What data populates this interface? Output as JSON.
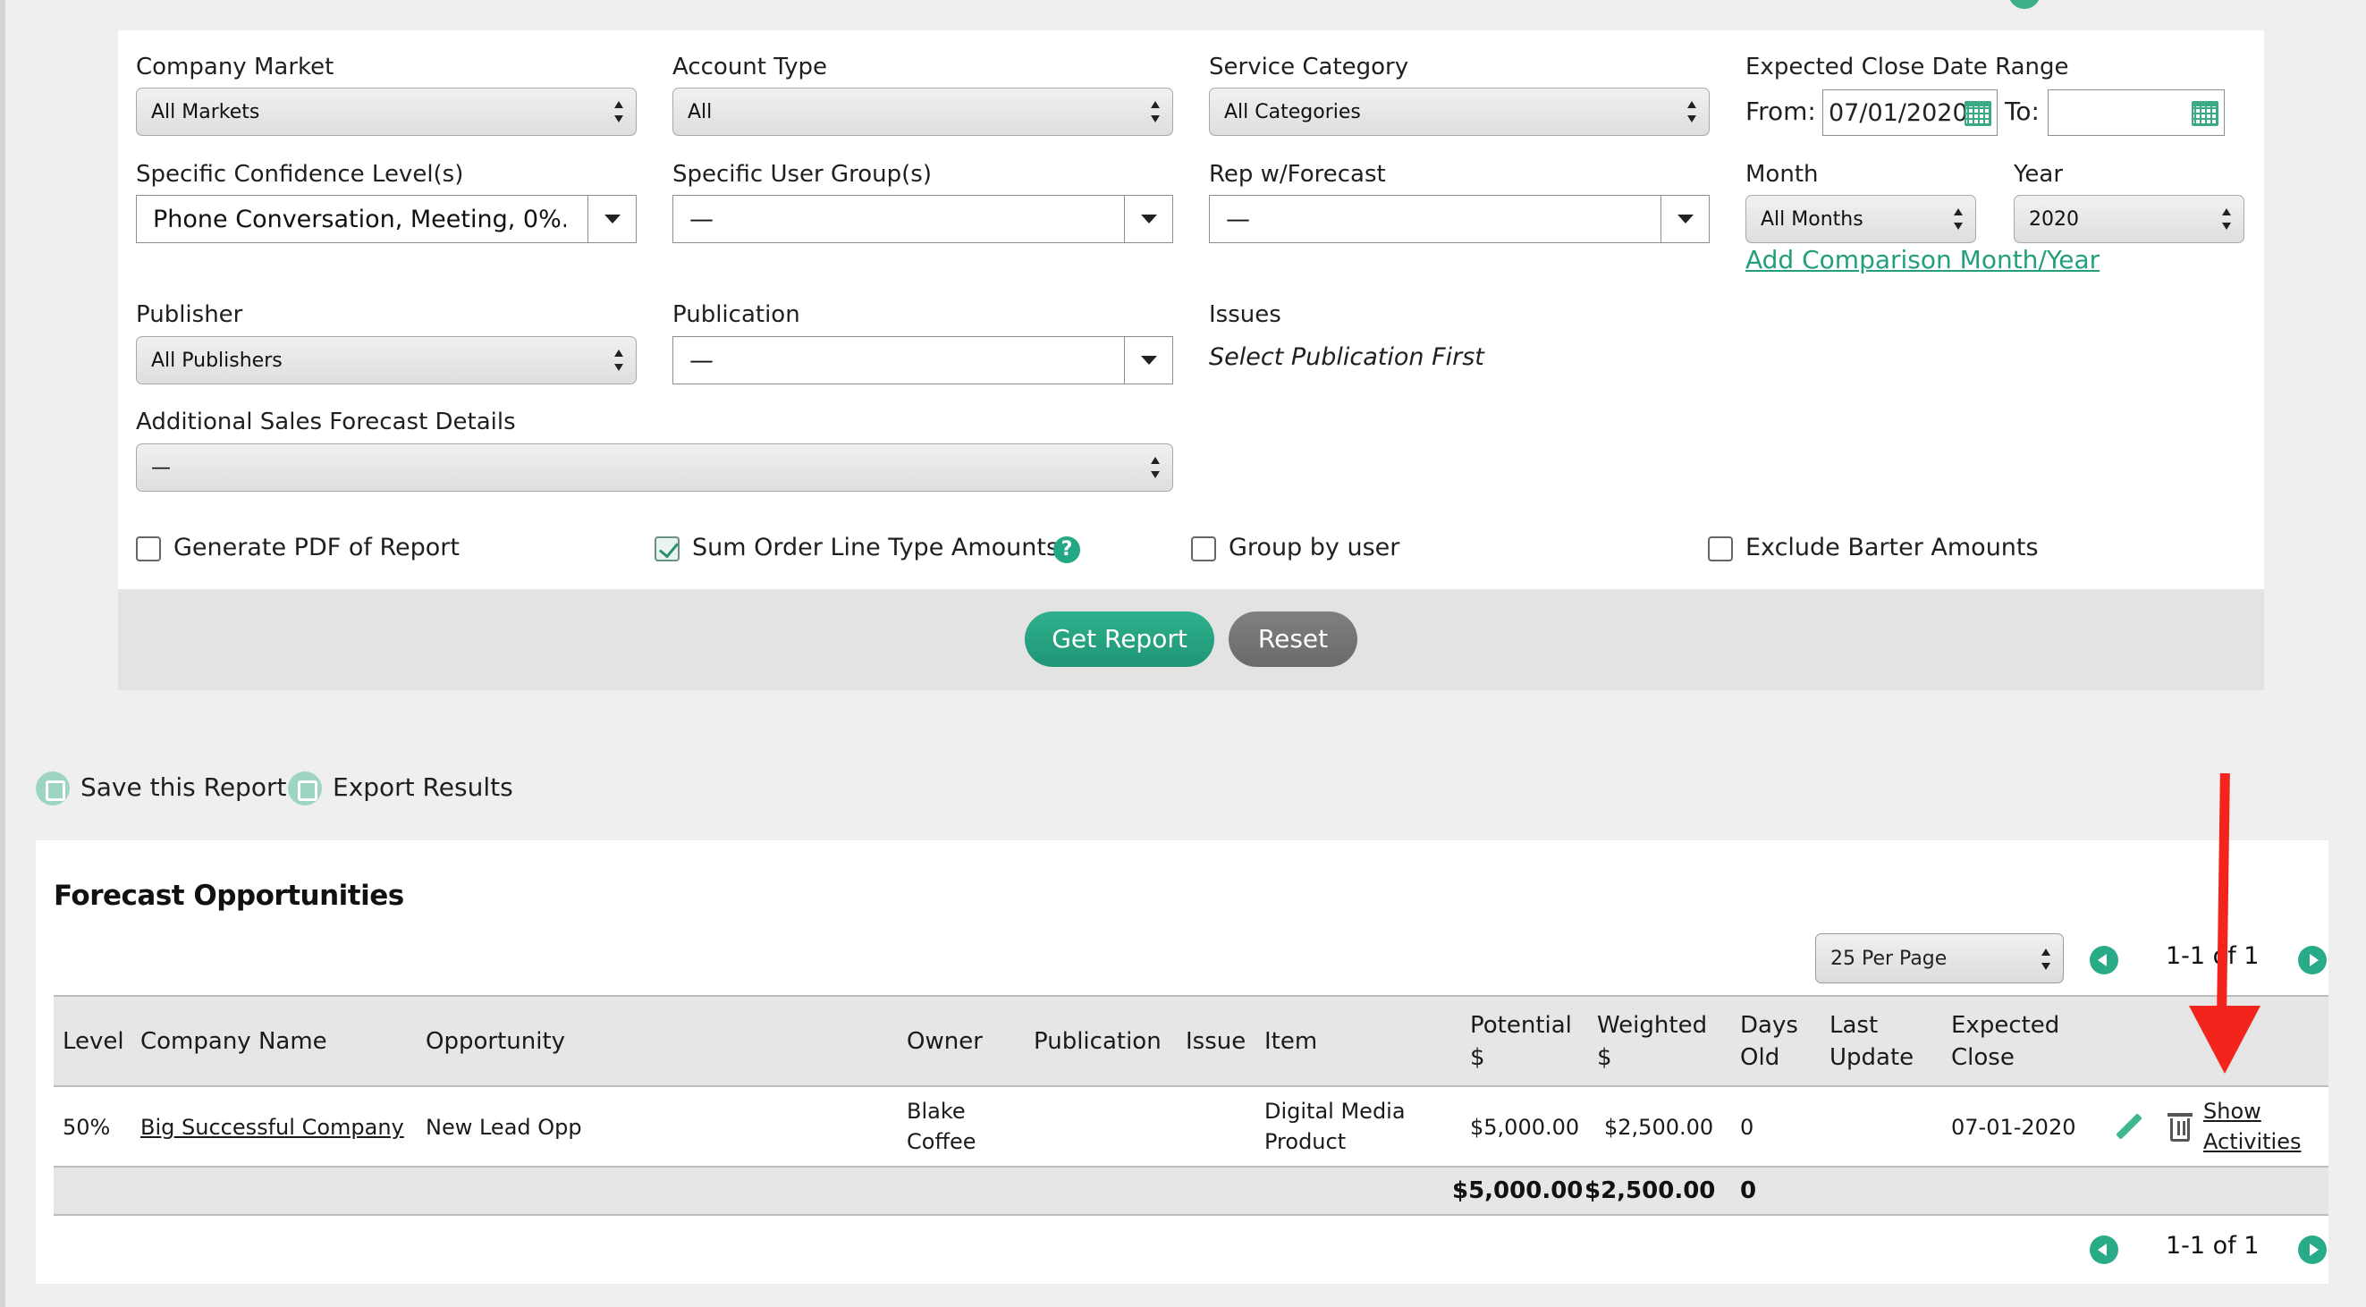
{
  "top": {
    "partial_text": "play"
  },
  "filters": {
    "company_market": {
      "label": "Company Market",
      "value": "All Markets"
    },
    "account_type": {
      "label": "Account Type",
      "value": "All"
    },
    "service_category": {
      "label": "Service Category",
      "value": "All Categories"
    },
    "close_date_range": {
      "label": "Expected Close Date Range",
      "from_label": "From:",
      "from_value": "07/01/2020",
      "to_label": "To:",
      "to_value": ""
    },
    "confidence_levels": {
      "label": "Specific Confidence Level(s)",
      "value": "Phone Conversation, Meeting, 0%..."
    },
    "user_groups": {
      "label": "Specific User Group(s)",
      "value": "—"
    },
    "rep_forecast": {
      "label": "Rep w/Forecast",
      "value": "—"
    },
    "month": {
      "label": "Month",
      "value": "All Months"
    },
    "year": {
      "label": "Year",
      "value": "2020"
    },
    "add_comparison": "Add Comparison Month/Year",
    "publisher": {
      "label": "Publisher",
      "value": "All Publishers"
    },
    "publication": {
      "label": "Publication",
      "value": "—"
    },
    "issues": {
      "label": "Issues",
      "value": "Select Publication First"
    },
    "additional_details": {
      "label": "Additional Sales Forecast Details",
      "value": "—"
    },
    "checkboxes": {
      "generate_pdf": {
        "label": "Generate PDF of Report",
        "checked": false
      },
      "sum_order_line": {
        "label": "Sum Order Line Type Amounts",
        "checked": true,
        "help": "?"
      },
      "group_by_user": {
        "label": "Group by user",
        "checked": false
      },
      "exclude_barter": {
        "label": "Exclude Barter Amounts",
        "checked": false
      }
    },
    "buttons": {
      "get_report": "Get Report",
      "reset": "Reset"
    }
  },
  "actions": {
    "save": "Save this Report",
    "export": "Export Results"
  },
  "results": {
    "title": "Forecast Opportunities",
    "per_page": "25 Per Page",
    "range_top": "1-1 of 1",
    "range_bottom": "1-1 of 1",
    "columns": {
      "level": "Level",
      "company": "Company Name",
      "opportunity": "Opportunity",
      "owner": "Owner",
      "publication": "Publication",
      "issue": "Issue",
      "item": "Item",
      "potential_1": "Potential",
      "potential_2": "$",
      "weighted_1": "Weighted",
      "weighted_2": "$",
      "days_1": "Days",
      "days_2": "Old",
      "update_1": "Last",
      "update_2": "Update",
      "close_1": "Expected",
      "close_2": "Close"
    },
    "row": {
      "level": "50%",
      "company": "Big Successful Company",
      "opportunity": "New Lead Opp",
      "owner_1": "Blake",
      "owner_2": "Coffee",
      "item_1": "Digital Media",
      "item_2": "Product",
      "potential": "$5,000.00",
      "weighted": "$2,500.00",
      "days_old": "0",
      "expected_close": "07-01-2020",
      "show_1": "Show",
      "show_2": "Activities"
    },
    "totals": {
      "potential": "$5,000.00",
      "weighted": "$2,500.00",
      "days_old": "0"
    }
  },
  "colors": {
    "accent": "#22a07c",
    "annotation_arrow": "#f2241c",
    "reset_button": "#6f6f6f"
  }
}
